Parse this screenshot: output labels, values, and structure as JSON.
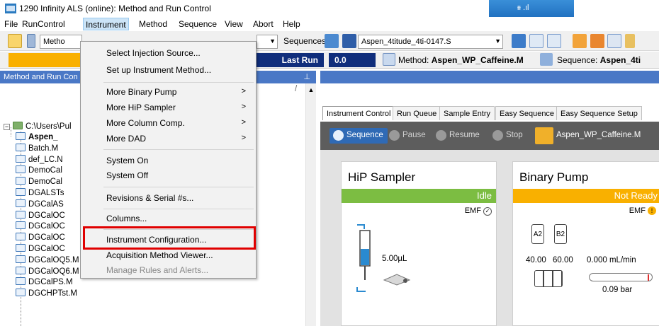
{
  "window": {
    "title": "1290 Infinity ALS (online): Method and Run Control",
    "signal_indicator": "ᵻᵻ .ıl"
  },
  "menubar": [
    "File",
    "RunControl",
    "Instrument",
    "Method",
    "Sequence",
    "View",
    "Abort",
    "Help"
  ],
  "toolbar": {
    "method_label": "Metho",
    "sequence_label": "Sequences",
    "sequence_file": "Aspen_4titude_4ti-0147.S"
  },
  "statusbar": {
    "last_run_label": "Last Run",
    "value": "0.0",
    "method_label": "Method:",
    "method_name": "Aspen_WP_Caffeine.M",
    "sequence_label": "Sequence:",
    "sequence_name": "Aspen_4ti"
  },
  "left_panel": {
    "title": "Method and Run Con",
    "pin": "⊥",
    "root_path": "C:\\Users\\Pul",
    "items": [
      "Aspen_",
      "Batch.M",
      "def_LC.N",
      "DemoCal",
      "DemoCal",
      "DGALSTs",
      "DGCalAS",
      "DGCalOC",
      "DGCalOC",
      "DGCalOC",
      "DGCalOC",
      "DGCalOQ5.M",
      "DGCalOQ6.M",
      "DGCalPS.M",
      "DGCHPTst.M"
    ]
  },
  "instrument_menu": {
    "items": [
      {
        "label": "Select Injection Source...",
        "submenu": false,
        "disabled": false
      },
      {
        "label": "Set up Instrument Method...",
        "submenu": false,
        "disabled": false
      },
      {
        "label": "More Binary Pump",
        "submenu": true,
        "disabled": false
      },
      {
        "label": "More HiP Sampler",
        "submenu": true,
        "disabled": false
      },
      {
        "label": "More Column Comp.",
        "submenu": true,
        "disabled": false
      },
      {
        "label": "More DAD",
        "submenu": true,
        "disabled": false
      },
      {
        "label": "System On",
        "submenu": false,
        "disabled": false
      },
      {
        "label": "System Off",
        "submenu": false,
        "disabled": false
      },
      {
        "label": "Revisions & Serial #s...",
        "submenu": false,
        "disabled": false
      },
      {
        "label": "Columns...",
        "submenu": false,
        "disabled": false
      },
      {
        "label": "Instrument Configuration...",
        "submenu": false,
        "disabled": false,
        "highlighted": true
      },
      {
        "label": "Acquisition Method Viewer...",
        "submenu": false,
        "disabled": false
      },
      {
        "label": "Manage Rules and Alerts...",
        "submenu": false,
        "disabled": true
      }
    ]
  },
  "right_panel": {
    "tabs": [
      "Instrument Control",
      "Run Queue",
      "Sample Entry",
      "Easy Sequence",
      "Easy Sequence Setup"
    ],
    "seq_buttons": [
      "Sequence",
      "Pause",
      "Resume",
      "Stop"
    ],
    "method_file": "Aspen_WP_Caffeine.M",
    "hip_sampler": {
      "title": "HiP Sampler",
      "status": "Idle",
      "emf": "EMF",
      "volume": "5.00µL"
    },
    "binary_pump": {
      "title": "Binary Pump",
      "status": "Not Ready",
      "emf": "EMF",
      "bottle_a": "A2",
      "bottle_b": "B2",
      "pct_a": "40.00",
      "pct_b": "60.00",
      "flow": "0.000 mL/min",
      "pressure": "0.09 bar"
    }
  },
  "colors": {
    "status_idle": "#7cbd42",
    "status_not_ready": "#f9b000",
    "highlight_box": "#e00000",
    "panel_header": "#4a78c6"
  }
}
